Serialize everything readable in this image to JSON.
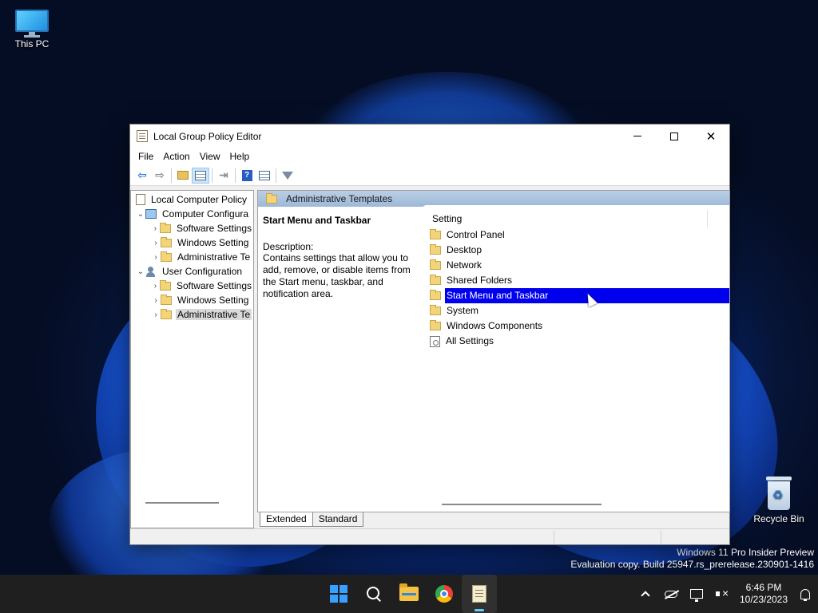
{
  "desktop": {
    "icons": [
      {
        "label": "This PC",
        "icon": "monitor-icon"
      },
      {
        "label": "Recycle Bin",
        "icon": "recycle-bin-icon"
      }
    ],
    "watermark": {
      "line1": "Windows 11 Pro Insider Preview",
      "line2": "Evaluation copy. Build 25947.rs_prerelease.230901-1416"
    }
  },
  "window": {
    "title": "Local Group Policy Editor",
    "controls": {
      "minimize": "minimize-icon",
      "maximize": "maximize-icon",
      "close": "✕"
    },
    "menu": [
      "File",
      "Action",
      "View",
      "Help"
    ],
    "toolbar": [
      "back-arrow-icon",
      "forward-arrow-icon",
      "up-folder-icon",
      "show-hide-tree-icon",
      "export-list-icon",
      "help-icon",
      "properties-icon",
      "filter-icon"
    ],
    "tree": {
      "root": "Local Computer Policy",
      "items": [
        {
          "label": "Computer Configura",
          "expanded": true
        },
        {
          "label": "Software Settings"
        },
        {
          "label": "Windows Setting"
        },
        {
          "label": "Administrative Te"
        },
        {
          "label": "User Configuration",
          "expanded": true
        },
        {
          "label": "Software Settings"
        },
        {
          "label": "Windows Setting"
        },
        {
          "label": "Administrative Te",
          "selected": true
        }
      ]
    },
    "pane": {
      "header": "Administrative Templates",
      "description_title": "Start Menu and Taskbar",
      "description_label": "Description:",
      "description_text": "Contains settings that allow you to add, remove, or disable items from the Start menu, taskbar, and notification area.",
      "column_header": "Setting",
      "items": [
        {
          "label": "Control Panel",
          "type": "folder"
        },
        {
          "label": "Desktop",
          "type": "folder"
        },
        {
          "label": "Network",
          "type": "folder"
        },
        {
          "label": "Shared Folders",
          "type": "folder"
        },
        {
          "label": "Start Menu and Taskbar",
          "type": "folder",
          "selected": true
        },
        {
          "label": "System",
          "type": "folder"
        },
        {
          "label": "Windows Components",
          "type": "folder"
        },
        {
          "label": "All Settings",
          "type": "settings"
        }
      ]
    },
    "tabs": [
      {
        "label": "Extended",
        "active": true
      },
      {
        "label": "Standard",
        "active": false
      }
    ]
  },
  "taskbar": {
    "apps": [
      "start-icon",
      "search-icon",
      "file-explorer-icon",
      "chrome-icon",
      "group-policy-editor-icon"
    ],
    "tray": {
      "icons": [
        "chevron-up-icon",
        "onedrive-icon",
        "network-icon",
        "volume-muted-icon",
        "notification-bell-icon"
      ],
      "time": "6:46 PM",
      "date": "10/23/2023"
    }
  },
  "colors": {
    "selection": "#0000ee",
    "pane_header": "#9db8d6",
    "taskbar": "#1f1f1f",
    "accent": "#3aa0ff"
  }
}
